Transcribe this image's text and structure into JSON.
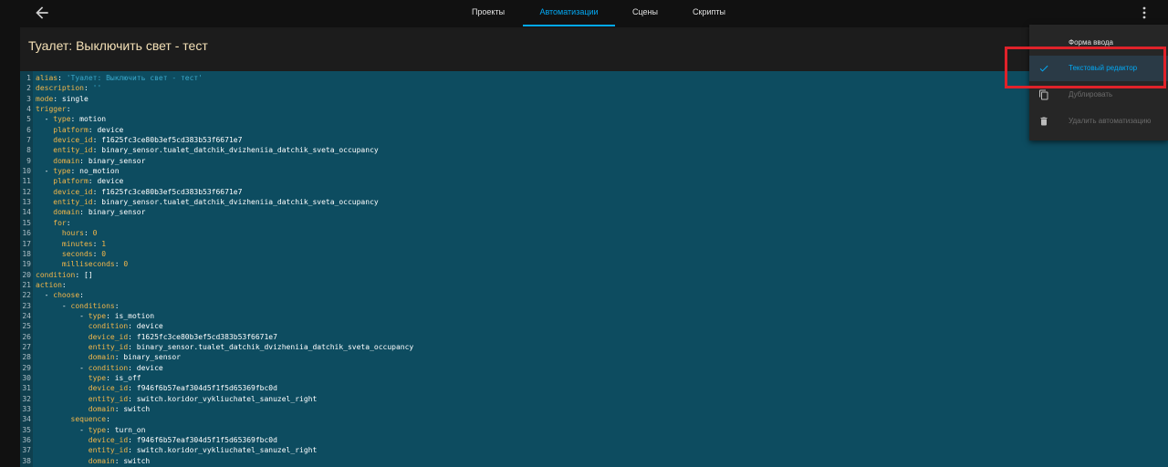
{
  "header": {
    "tabs": [
      {
        "label": "Проекты",
        "active": false
      },
      {
        "label": "Автоматизации",
        "active": true
      },
      {
        "label": "Сцены",
        "active": false
      },
      {
        "label": "Скрипты",
        "active": false
      }
    ]
  },
  "editor": {
    "title": "Туалет: Выключить свет - тест",
    "lines": [
      {
        "no": "1",
        "key": "alias",
        "sep": ": ",
        "val": "'Туалет: Выключить свет - тест'",
        "kind": "s",
        "indent": ""
      },
      {
        "no": "2",
        "key": "description",
        "sep": ": ",
        "val": "''",
        "kind": "s",
        "indent": ""
      },
      {
        "no": "3",
        "key": "mode",
        "sep": ": ",
        "val": "single",
        "kind": "v",
        "indent": ""
      },
      {
        "no": "4",
        "key": "trigger",
        "sep": ":",
        "val": "",
        "kind": "v",
        "indent": ""
      },
      {
        "no": "5",
        "key": "type",
        "sep": ": ",
        "val": "motion",
        "kind": "v",
        "indent": "  - "
      },
      {
        "no": "6",
        "key": "platform",
        "sep": ": ",
        "val": "device",
        "kind": "v",
        "indent": "    "
      },
      {
        "no": "7",
        "key": "device_id",
        "sep": ": ",
        "val": "f1625fc3ce80b3ef5cd383b53f6671e7",
        "kind": "v",
        "indent": "    "
      },
      {
        "no": "8",
        "key": "entity_id",
        "sep": ": ",
        "val": "binary_sensor.tualet_datchik_dvizheniia_datchik_sveta_occupancy",
        "kind": "v",
        "indent": "    "
      },
      {
        "no": "9",
        "key": "domain",
        "sep": ": ",
        "val": "binary_sensor",
        "kind": "v",
        "indent": "    "
      },
      {
        "no": "10",
        "key": "type",
        "sep": ": ",
        "val": "no_motion",
        "kind": "v",
        "indent": "  - "
      },
      {
        "no": "11",
        "key": "platform",
        "sep": ": ",
        "val": "device",
        "kind": "v",
        "indent": "    "
      },
      {
        "no": "12",
        "key": "device_id",
        "sep": ": ",
        "val": "f1625fc3ce80b3ef5cd383b53f6671e7",
        "kind": "v",
        "indent": "    "
      },
      {
        "no": "13",
        "key": "entity_id",
        "sep": ": ",
        "val": "binary_sensor.tualet_datchik_dvizheniia_datchik_sveta_occupancy",
        "kind": "v",
        "indent": "    "
      },
      {
        "no": "14",
        "key": "domain",
        "sep": ": ",
        "val": "binary_sensor",
        "kind": "v",
        "indent": "    "
      },
      {
        "no": "15",
        "key": "for",
        "sep": ":",
        "val": "",
        "kind": "v",
        "indent": "    "
      },
      {
        "no": "16",
        "key": "hours",
        "sep": ": ",
        "val": "0",
        "kind": "n",
        "indent": "      "
      },
      {
        "no": "17",
        "key": "minutes",
        "sep": ": ",
        "val": "1",
        "kind": "n",
        "indent": "      "
      },
      {
        "no": "18",
        "key": "seconds",
        "sep": ": ",
        "val": "0",
        "kind": "n",
        "indent": "      "
      },
      {
        "no": "19",
        "key": "milliseconds",
        "sep": ": ",
        "val": "0",
        "kind": "n",
        "indent": "      "
      },
      {
        "no": "20",
        "key": "condition",
        "sep": ": ",
        "val": "[]",
        "kind": "v",
        "indent": ""
      },
      {
        "no": "21",
        "key": "action",
        "sep": ":",
        "val": "",
        "kind": "v",
        "indent": ""
      },
      {
        "no": "22",
        "key": "choose",
        "sep": ":",
        "val": "",
        "kind": "v",
        "indent": "  - "
      },
      {
        "no": "23",
        "key": "conditions",
        "sep": ":",
        "val": "",
        "kind": "v",
        "indent": "      - "
      },
      {
        "no": "24",
        "key": "type",
        "sep": ": ",
        "val": "is_motion",
        "kind": "v",
        "indent": "          - "
      },
      {
        "no": "25",
        "key": "condition",
        "sep": ": ",
        "val": "device",
        "kind": "v",
        "indent": "            "
      },
      {
        "no": "26",
        "key": "device_id",
        "sep": ": ",
        "val": "f1625fc3ce80b3ef5cd383b53f6671e7",
        "kind": "v",
        "indent": "            "
      },
      {
        "no": "27",
        "key": "entity_id",
        "sep": ": ",
        "val": "binary_sensor.tualet_datchik_dvizheniia_datchik_sveta_occupancy",
        "kind": "v",
        "indent": "            "
      },
      {
        "no": "28",
        "key": "domain",
        "sep": ": ",
        "val": "binary_sensor",
        "kind": "v",
        "indent": "            "
      },
      {
        "no": "29",
        "key": "condition",
        "sep": ": ",
        "val": "device",
        "kind": "v",
        "indent": "          - "
      },
      {
        "no": "30",
        "key": "type",
        "sep": ": ",
        "val": "is_off",
        "kind": "v",
        "indent": "            "
      },
      {
        "no": "31",
        "key": "device_id",
        "sep": ": ",
        "val": "f946f6b57eaf304d5f1f5d65369fbc0d",
        "kind": "v",
        "indent": "            "
      },
      {
        "no": "32",
        "key": "entity_id",
        "sep": ": ",
        "val": "switch.koridor_vykliuchatel_sanuzel_right",
        "kind": "v",
        "indent": "            "
      },
      {
        "no": "33",
        "key": "domain",
        "sep": ": ",
        "val": "switch",
        "kind": "v",
        "indent": "            "
      },
      {
        "no": "34",
        "key": "sequence",
        "sep": ":",
        "val": "",
        "kind": "v",
        "indent": "        "
      },
      {
        "no": "35",
        "key": "type",
        "sep": ": ",
        "val": "turn_on",
        "kind": "v",
        "indent": "          - "
      },
      {
        "no": "36",
        "key": "device_id",
        "sep": ": ",
        "val": "f946f6b57eaf304d5f1f5d65369fbc0d",
        "kind": "v",
        "indent": "            "
      },
      {
        "no": "37",
        "key": "entity_id",
        "sep": ": ",
        "val": "switch.koridor_vykliuchatel_sanuzel_right",
        "kind": "v",
        "indent": "            "
      },
      {
        "no": "38",
        "key": "domain",
        "sep": ": ",
        "val": "switch",
        "kind": "v",
        "indent": "            "
      }
    ]
  },
  "menu": {
    "items": [
      {
        "label": "Форма ввода",
        "selected": false,
        "disabled": false,
        "icon": "none"
      },
      {
        "label": "Текстовый редактор",
        "selected": true,
        "disabled": false,
        "icon": "check-icon"
      },
      {
        "label": "Дублировать",
        "selected": false,
        "disabled": true,
        "icon": "copy-icon"
      },
      {
        "label": "Удалить автоматизацию",
        "selected": false,
        "disabled": true,
        "icon": "trash-icon"
      }
    ]
  },
  "colors": {
    "accent": "#03a9f4",
    "editor_bg": "#0d4c60",
    "yaml_key": "#f3b74a",
    "yaml_string": "#3aa7c9",
    "title": "#f4e0b6",
    "annotation": "#e0222a"
  }
}
